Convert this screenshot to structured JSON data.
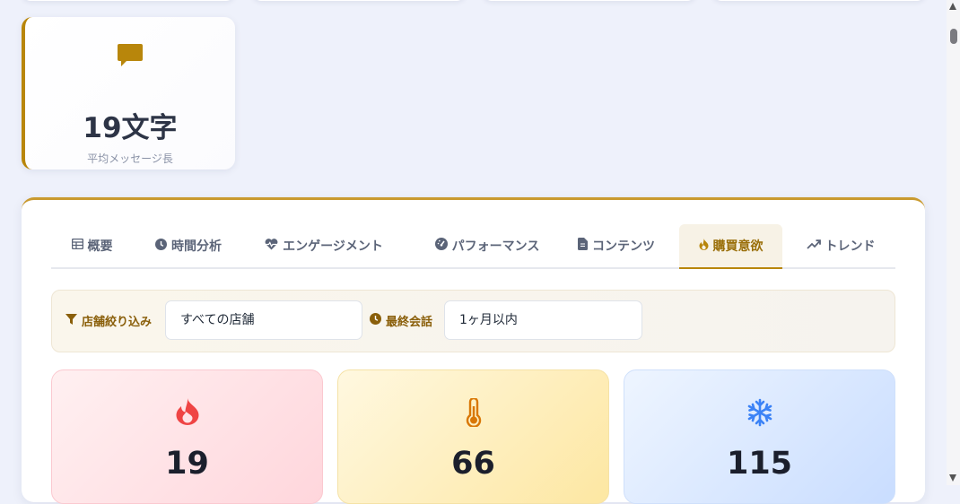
{
  "stat_card": {
    "value": "19文字",
    "label": "平均メッセージ長",
    "icon": "chat-bubble-icon"
  },
  "tabs": [
    {
      "label": "概要",
      "icon": "table-icon"
    },
    {
      "label": "時間分析",
      "icon": "clock-icon"
    },
    {
      "label": "エンゲージメント",
      "icon": "heart-pulse-icon"
    },
    {
      "label": "パフォーマンス",
      "icon": "gauge-icon"
    },
    {
      "label": "コンテンツ",
      "icon": "document-icon"
    },
    {
      "label": "購買意欲",
      "icon": "fire-icon",
      "active": true
    },
    {
      "label": "トレンド",
      "icon": "trend-up-icon"
    }
  ],
  "filters": {
    "store_label": "店舗絞り込み",
    "store_value": "すべての店舗",
    "last_label": "最終会話",
    "last_value": "1ヶ月以内"
  },
  "intent_cards": {
    "hot": {
      "count": "19",
      "icon": "fire-icon",
      "color": "#ef4444"
    },
    "warm": {
      "count": "66",
      "icon": "thermometer-icon",
      "color": "#d97706"
    },
    "cold": {
      "count": "115",
      "icon": "snowflake-icon",
      "color": "#3b82f6"
    }
  },
  "colors": {
    "accent": "#b8860b",
    "active_tab_text": "#9a6f0a"
  }
}
